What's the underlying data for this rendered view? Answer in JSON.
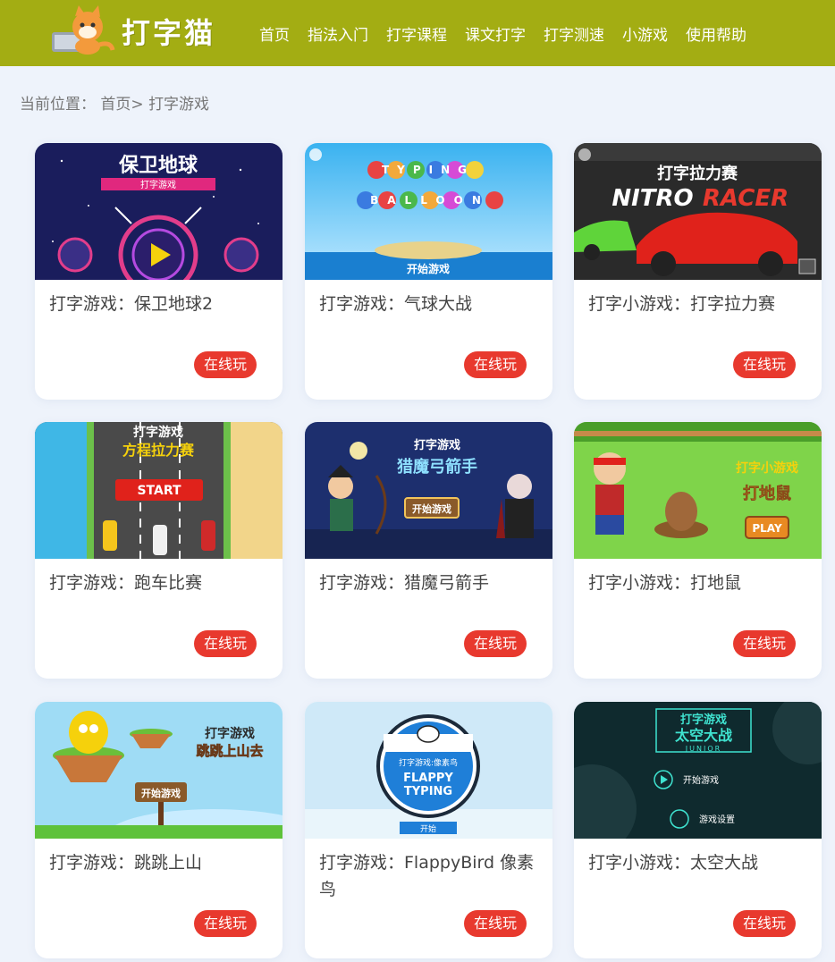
{
  "header": {
    "logo_text": "打字猫",
    "nav": [
      "首页",
      "指法入门",
      "打字课程",
      "课文打字",
      "打字测速",
      "小游戏",
      "使用帮助"
    ]
  },
  "breadcrumb": {
    "prefix": "当前位置：",
    "home": "首页",
    "separator": ">",
    "current": "打字游戏"
  },
  "colors": {
    "header_bg": "#a3ad13",
    "page_bg": "#eef3fb",
    "play_button": "#e8392e"
  },
  "play_label": "在线玩",
  "games": [
    {
      "title": "打字游戏：保卫地球2",
      "art": {
        "text_1": "保卫地球",
        "text_2": "打字游戏"
      }
    },
    {
      "title": "打字游戏：气球大战",
      "art": {
        "text_1": "TYPING",
        "text_2": "BALLOON",
        "text_3": "开始游戏"
      }
    },
    {
      "title": "打字小游戏：打字拉力赛",
      "art": {
        "text_1": "打字拉力赛",
        "text_2": "NITRO",
        "text_3": "RACER"
      }
    },
    {
      "title": "打字游戏：跑车比赛",
      "art": {
        "text_1": "打字游戏",
        "text_2": "方程拉力赛",
        "text_3": "START"
      }
    },
    {
      "title": "打字游戏：猎魔弓箭手",
      "art": {
        "text_1": "打字游戏",
        "text_2": "猎魔弓箭手",
        "text_3": "开始游戏"
      }
    },
    {
      "title": "打字小游戏：打地鼠",
      "art": {
        "text_1": "打字小游戏",
        "text_2": "打地鼠",
        "text_3": "PLAY"
      }
    },
    {
      "title": "打字游戏：跳跳上山",
      "art": {
        "text_1": "打字游戏",
        "text_2": "跳跳上山去",
        "text_3": "开始游戏"
      }
    },
    {
      "title": "打字游戏：FlappyBird 像素鸟",
      "art": {
        "text_1": "打字游戏:像素鸟",
        "text_2": "FLAPPY",
        "text_3": "TYPING",
        "text_4": "开始"
      }
    },
    {
      "title": "打字小游戏：太空大战",
      "art": {
        "text_1": "打字游戏",
        "text_2": "太空大战",
        "text_3": "JUNIOR",
        "text_4": "开始游戏",
        "text_5": "游戏设置"
      }
    }
  ]
}
